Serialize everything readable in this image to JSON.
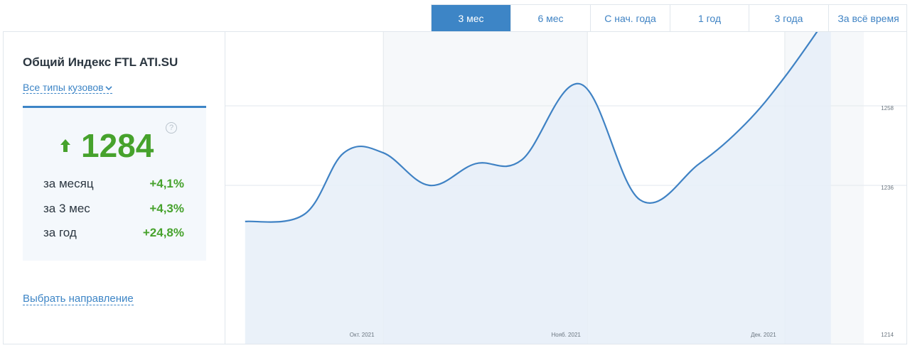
{
  "tabs": [
    {
      "label": "3 мес",
      "active": true
    },
    {
      "label": "6 мес",
      "active": false
    },
    {
      "label": "С нач. года",
      "active": false
    },
    {
      "label": "1 год",
      "active": false
    },
    {
      "label": "3 года",
      "active": false
    },
    {
      "label": "За всё время",
      "active": false
    }
  ],
  "sidebar": {
    "title": "Общий Индекс FTL ATI.SU",
    "body_type": "Все типы кузовов",
    "index_value": "1284",
    "trend": "up",
    "help_symbol": "?",
    "stats": [
      {
        "label": "за месяц",
        "value": "+4,1%"
      },
      {
        "label": "за 3 мес",
        "value": "+4,3%"
      },
      {
        "label": "за год",
        "value": "+24,8%"
      }
    ],
    "direction_link": "Выбрать направление"
  },
  "colors": {
    "accent": "#3d85c6",
    "positive": "#46a22c",
    "line": "#3f82c4",
    "area": "#e6eef8"
  },
  "chart_data": {
    "type": "area",
    "x_labels": [
      "Окт. 2021",
      "Нояб. 2021",
      "Дек. 2021"
    ],
    "y_ticks": [
      "1258",
      "1236",
      "1214"
    ],
    "ylim": [
      1214,
      1280
    ],
    "series": [
      {
        "values": [
          {
            "x": "2021-09-10",
            "y": 1226
          },
          {
            "x": "2021-09-19",
            "y": 1228
          },
          {
            "x": "2021-09-25",
            "y": 1245
          },
          {
            "x": "2021-10-01",
            "y": 1245
          },
          {
            "x": "2021-10-08",
            "y": 1236
          },
          {
            "x": "2021-10-15",
            "y": 1242
          },
          {
            "x": "2021-10-22",
            "y": 1243
          },
          {
            "x": "2021-10-31",
            "y": 1264
          },
          {
            "x": "2021-11-09",
            "y": 1232
          },
          {
            "x": "2021-11-18",
            "y": 1242
          },
          {
            "x": "2021-11-25",
            "y": 1253
          },
          {
            "x": "2021-12-01",
            "y": 1266
          },
          {
            "x": "2021-12-08",
            "y": 1284
          }
        ]
      }
    ],
    "last_value_label": "1284",
    "grid": true
  }
}
